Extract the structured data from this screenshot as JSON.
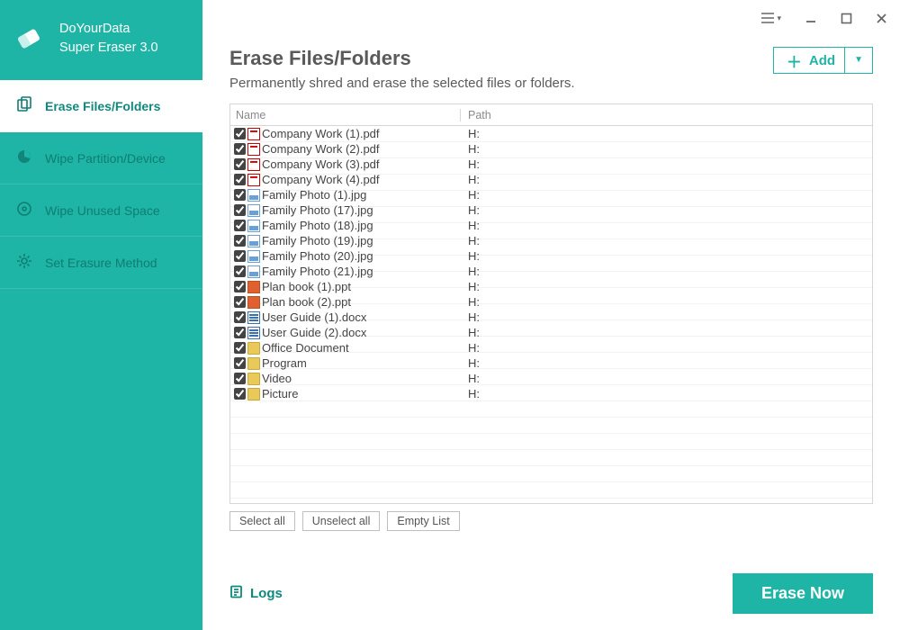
{
  "brand": {
    "line1": "DoYourData",
    "line2": "Super Eraser 3.0"
  },
  "sidebar": {
    "items": [
      {
        "label": "Erase Files/Folders",
        "icon": "copy-icon",
        "active": true
      },
      {
        "label": "Wipe Partition/Device",
        "icon": "piechart-icon",
        "active": false
      },
      {
        "label": "Wipe Unused Space",
        "icon": "disk-icon",
        "active": false
      },
      {
        "label": "Set Erasure Method",
        "icon": "gear-icon",
        "active": false
      }
    ]
  },
  "header": {
    "title": "Erase Files/Folders",
    "subtitle": "Permanently shred and erase the selected files or folders.",
    "add_label": "Add"
  },
  "columns": {
    "name": "Name",
    "path": "Path"
  },
  "files": [
    {
      "name": "Company Work (1).pdf",
      "path": "H:",
      "ftype": "pdf"
    },
    {
      "name": "Company Work (2).pdf",
      "path": "H:",
      "ftype": "pdf"
    },
    {
      "name": "Company Work (3).pdf",
      "path": "H:",
      "ftype": "pdf"
    },
    {
      "name": "Company Work (4).pdf",
      "path": "H:",
      "ftype": "pdf"
    },
    {
      "name": "Family Photo (1).jpg",
      "path": "H:",
      "ftype": "jpg"
    },
    {
      "name": "Family Photo (17).jpg",
      "path": "H:",
      "ftype": "jpg"
    },
    {
      "name": "Family Photo (18).jpg",
      "path": "H:",
      "ftype": "jpg"
    },
    {
      "name": "Family Photo (19).jpg",
      "path": "H:",
      "ftype": "jpg"
    },
    {
      "name": "Family Photo (20).jpg",
      "path": "H:",
      "ftype": "jpg"
    },
    {
      "name": "Family Photo (21).jpg",
      "path": "H:",
      "ftype": "jpg"
    },
    {
      "name": "Plan book (1).ppt",
      "path": "H:",
      "ftype": "ppt"
    },
    {
      "name": "Plan book (2).ppt",
      "path": "H:",
      "ftype": "ppt"
    },
    {
      "name": "User Guide (1).docx",
      "path": "H:",
      "ftype": "doc"
    },
    {
      "name": "User Guide (2).docx",
      "path": "H:",
      "ftype": "doc"
    },
    {
      "name": "Office Document",
      "path": "H:",
      "ftype": "folder"
    },
    {
      "name": "Program",
      "path": "H:",
      "ftype": "folder"
    },
    {
      "name": "Video",
      "path": "H:",
      "ftype": "folder"
    },
    {
      "name": "Picture",
      "path": "H:",
      "ftype": "folder"
    }
  ],
  "actions": {
    "select_all": "Select all",
    "unselect_all": "Unselect all",
    "empty_list": "Empty List"
  },
  "footer": {
    "logs": "Logs",
    "erase": "Erase Now"
  },
  "colors": {
    "accent": "#1eb5a6",
    "accent_dark": "#0f897e"
  }
}
